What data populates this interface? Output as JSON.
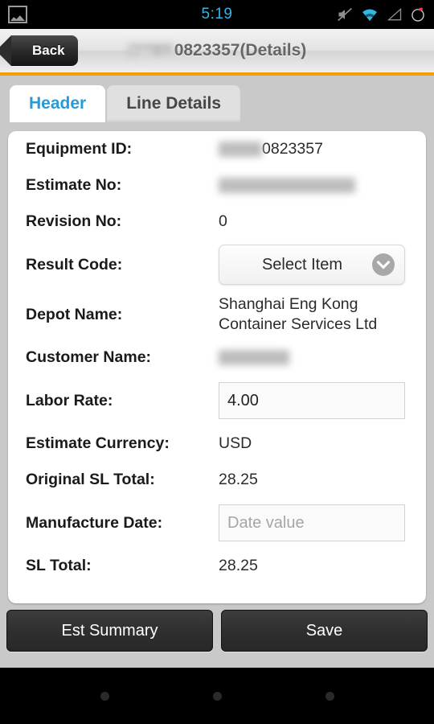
{
  "statusbar": {
    "time": "5:19",
    "icons": {
      "gallery": "image-icon",
      "mute": "volume-muted-icon",
      "wifi": "wifi-icon",
      "signal": "cell-signal-icon",
      "battery": "battery-icon"
    },
    "accent_color": "#33b5e5"
  },
  "titlebar": {
    "back_label": "Back",
    "title_redacted_prefix": "TRLU",
    "title": "0823357(Details)",
    "underline_color": "#f2a009"
  },
  "tabs": [
    {
      "label": "Header",
      "active": true
    },
    {
      "label": "Line Details",
      "active": false
    }
  ],
  "form": {
    "fields": [
      {
        "label": "Equipment ID:",
        "type": "text-redacted-prefix",
        "redacted": "TRLU",
        "value": "0823357"
      },
      {
        "label": "Estimate No:",
        "type": "text-redacted",
        "redacted": "CNSHAEKGA24299",
        "value": ""
      },
      {
        "label": "Revision No:",
        "type": "text",
        "value": "0"
      },
      {
        "label": "Result Code:",
        "type": "dropdown",
        "value": "Select Item"
      },
      {
        "label": "Depot Name:",
        "type": "text-multiline",
        "value": "Shanghai Eng Kong Container Services Ltd"
      },
      {
        "label": "Customer Name:",
        "type": "text-redacted",
        "redacted": "ChinaNav",
        "value": ""
      },
      {
        "label": "Labor Rate:",
        "type": "input",
        "value": "4.00",
        "placeholder": ""
      },
      {
        "label": "Estimate Currency:",
        "type": "text",
        "value": "USD"
      },
      {
        "label": "Original SL Total:",
        "type": "text",
        "value": "28.25"
      },
      {
        "label": "Manufacture Date:",
        "type": "input",
        "value": "",
        "placeholder": "Date value"
      },
      {
        "label": "SL Total:",
        "type": "text",
        "value": "28.25"
      }
    ]
  },
  "actions": {
    "est_summary_label": "Est Summary",
    "save_label": "Save"
  },
  "navbar": {
    "buttons": [
      "back-nav-button",
      "home-nav-button",
      "recents-nav-button"
    ]
  }
}
